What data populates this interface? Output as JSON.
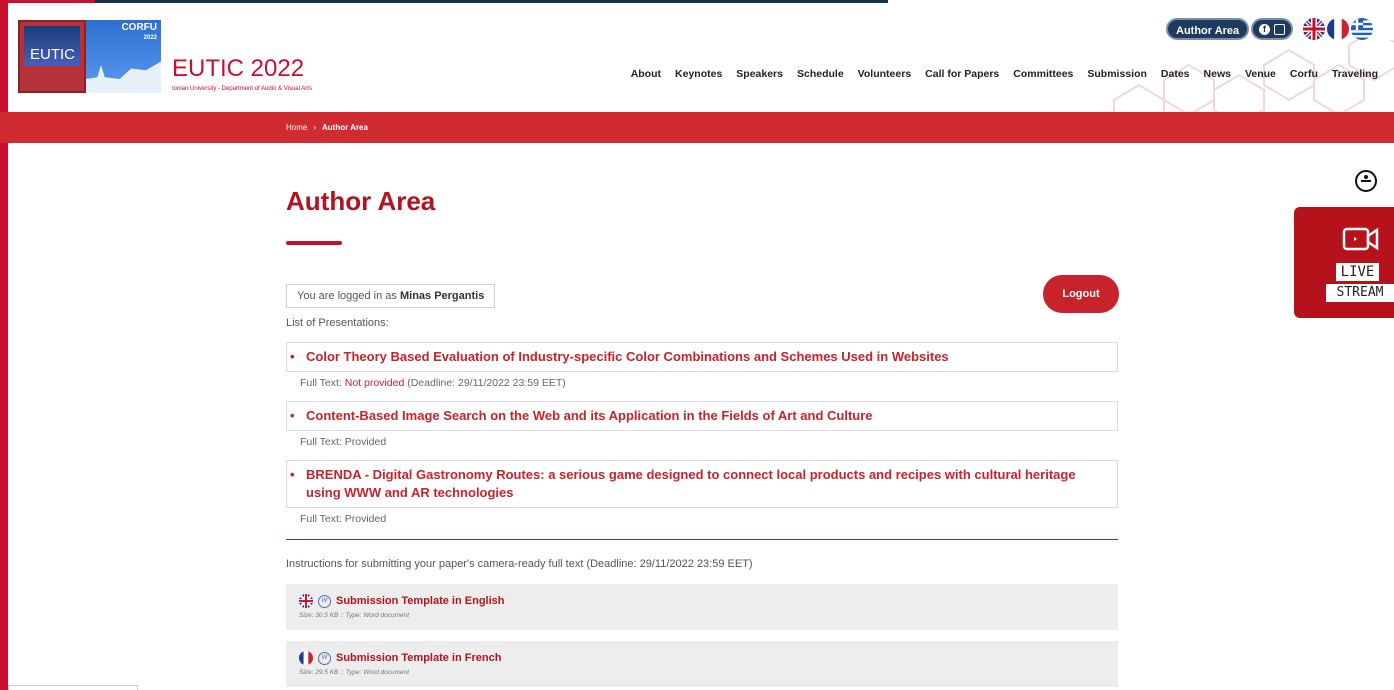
{
  "header": {
    "logo_text": "EUTIC",
    "logo_corfu": "CORFU",
    "logo_year": "2022",
    "site_title": "EUTIC 2022",
    "site_subtitle": "Ionian University - Department of Audio & Visual Arts",
    "author_area_label": "Author Area",
    "nav": [
      "About",
      "Keynotes",
      "Speakers",
      "Schedule",
      "Volunteers",
      "Call for Papers",
      "Committees",
      "Submission",
      "Dates",
      "News",
      "Venue",
      "Corfu",
      "Traveling"
    ],
    "languages": [
      "English",
      "French",
      "Greek"
    ]
  },
  "breadcrumb": {
    "home": "Home",
    "current": "Author Area"
  },
  "main": {
    "title": "Author Area",
    "login_prefix": "You are logged in as",
    "user_name": "Minas Pergantis",
    "logout_label": "Logout",
    "list_label": "List of Presentations:",
    "presentations": [
      {
        "title": "Color Theory Based Evaluation of Industry-specific Color Combinations and Schemes Used in Websites",
        "fulltext_label": "Full Text:",
        "status": "Not provided",
        "deadline": "(Deadline: 29/11/2022 23:59 EET)"
      },
      {
        "title": "Content-Based Image Search on the Web and its Application in the Fields of Art and Culture",
        "fulltext_label": "Full Text:",
        "status": "Provided",
        "deadline": ""
      },
      {
        "title": "BRENDA - Digital Gastronomy Routes: a serious game designed to connect local products and recipes with cultural heritage using WWW and AR technologies",
        "fulltext_label": "Full Text:",
        "status": "Provided",
        "deadline": ""
      }
    ],
    "instructions": "Instructions for submitting your paper's camera-ready full text (Deadline: 29/11/2022 23:59 EET)",
    "templates": [
      {
        "title": "Submission Template in English",
        "meta": "Size: 30.5 KB :: Type: Word document",
        "flag": "uk-flag"
      },
      {
        "title": "Submission Template in French",
        "meta": "Size: 29.5 KB :: Type: Word document",
        "flag": "fr-flag"
      }
    ]
  },
  "side": {
    "live_line1": "LIVE",
    "live_line2": "STREAM"
  },
  "colors": {
    "brand_red": "#c8102e",
    "navy": "#1f3a5f"
  }
}
